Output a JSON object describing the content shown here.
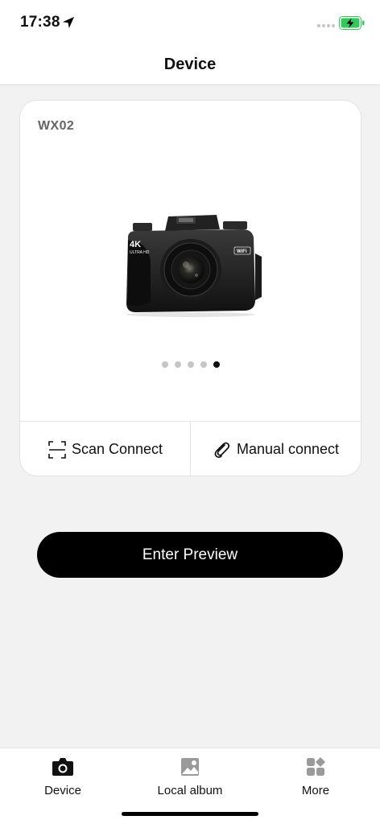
{
  "status_bar": {
    "time": "17:38",
    "icons": [
      "location-arrow-icon",
      "signal-dots-icon",
      "battery-charging-icon"
    ],
    "battery_color": "#34c759"
  },
  "nav": {
    "title": "Device"
  },
  "device_card": {
    "device_name": "WX02",
    "image": "camera-product-image",
    "pager": {
      "total": 5,
      "active_index": 4
    },
    "scan_label": "Scan Connect",
    "manual_label": "Manual connect"
  },
  "preview_button": {
    "label": "Enter Preview"
  },
  "tab_bar": {
    "tabs": [
      {
        "label": "Device",
        "icon": "camera-icon",
        "active": true,
        "color": "#111111"
      },
      {
        "label": "Local album",
        "icon": "image-album-icon",
        "active": false,
        "color": "#9a9a9a"
      },
      {
        "label": "More",
        "icon": "grid-more-icon",
        "active": false,
        "color": "#9a9a9a"
      }
    ]
  }
}
